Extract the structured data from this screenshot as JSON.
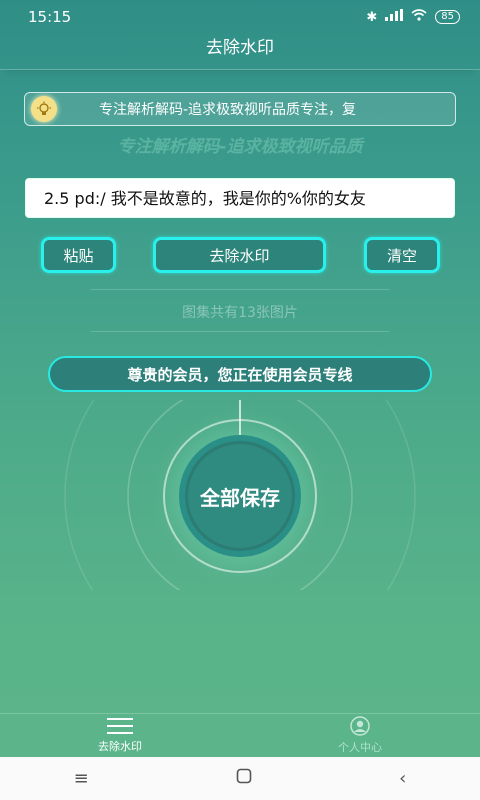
{
  "status_bar": {
    "time": "15:15",
    "battery": "85"
  },
  "header": {
    "title": "去除水印"
  },
  "notice": {
    "text": "专注解析解码-追求极致视听品质专注，复"
  },
  "ghost_text": "专注解析解码-追求极致视听品质",
  "input": {
    "value": "2.5 pd:/ 我不是故意的，我是你的%你的女友"
  },
  "buttons": {
    "paste": "粘贴",
    "remove": "去除水印",
    "clear": "清空"
  },
  "count_text": "图集共有13张图片",
  "member_banner": "尊贵的会员，您正在使用会员专线",
  "save_button": "全部保存",
  "tabs": [
    {
      "label": "去除水印",
      "icon": "menu-icon"
    },
    {
      "label": "个人中心",
      "icon": "user-icon"
    }
  ],
  "colors": {
    "accent": "#28f0ec",
    "input_bg": "#ffffff"
  }
}
